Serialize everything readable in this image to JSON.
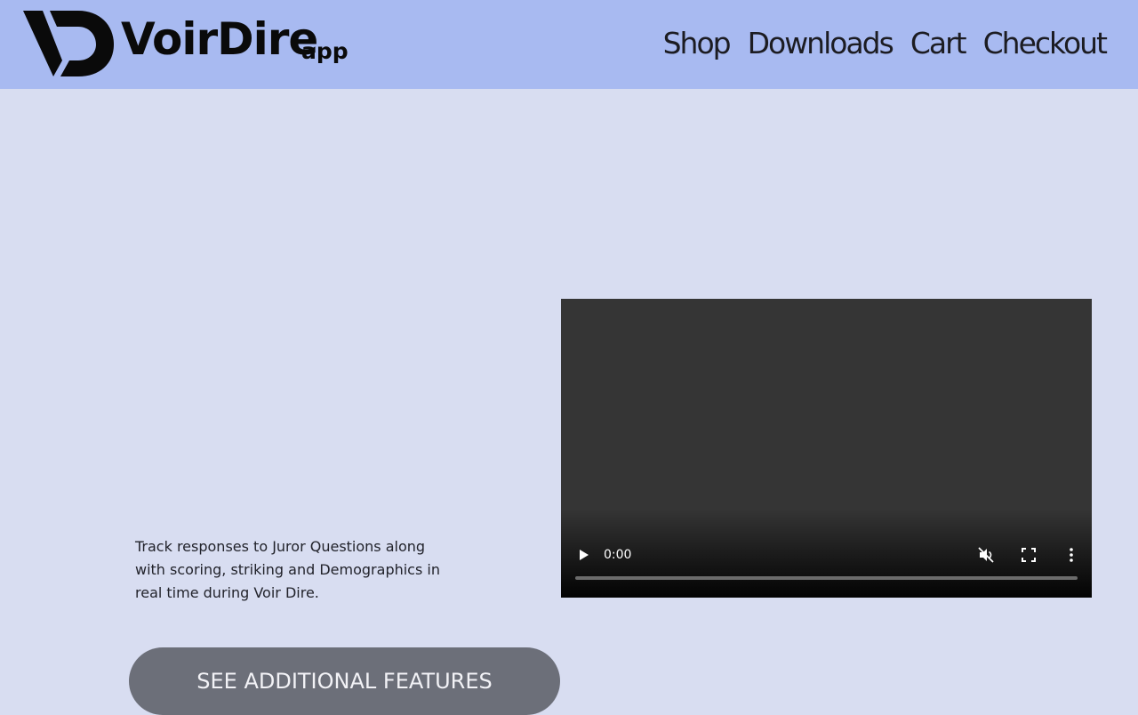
{
  "brand": {
    "name": "VoirDire",
    "suffix": "app"
  },
  "nav": {
    "items": [
      {
        "label": "Shop"
      },
      {
        "label": "Downloads"
      },
      {
        "label": "Cart"
      },
      {
        "label": "Checkout"
      }
    ]
  },
  "hero": {
    "description": "Track responses to Juror Questions along with scoring, striking and Demographics in real time during Voir Dire.",
    "cta_label": "SEE ADDITIONAL FEATURES"
  },
  "video": {
    "current_time": "0:00",
    "progress": 0,
    "icons": [
      "play-icon",
      "mute-icon",
      "fullscreen-icon",
      "more-options-icon"
    ]
  },
  "colors": {
    "header_bg": "#a8baf1",
    "page_bg": "#d8ddf1",
    "video_bg": "#353535",
    "button_bg": "#6c6f79"
  }
}
